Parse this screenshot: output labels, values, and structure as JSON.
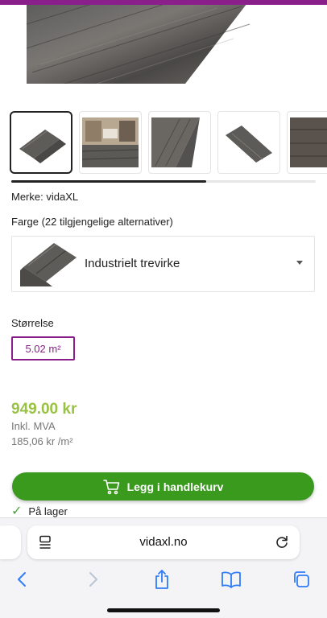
{
  "brand": {
    "label": "Merke: vidaXL"
  },
  "colors": {
    "label": "Farge (22 tilgjengelige alternativer)",
    "selected": "Industrielt trevirke"
  },
  "size": {
    "label": "Størrelse",
    "selected": "5.02 m²"
  },
  "pricing": {
    "price": "949.00 kr",
    "vat_note": "Inkl. MVA",
    "unit_price": "185,06 kr /m²"
  },
  "cart": {
    "button_label": "Legg i handlekurv",
    "icon": "cart-icon"
  },
  "stock": {
    "label": "På lager",
    "icon": "check-icon"
  },
  "browser": {
    "url": "vidaxl.no",
    "icons": [
      "reader-icon",
      "reload-icon",
      "back-icon",
      "forward-icon",
      "share-icon",
      "bookmarks-icon",
      "tabs-icon"
    ]
  },
  "theme": {
    "accent": "#8a1e8a",
    "price_color": "#99c244",
    "cart_green": "#3a9a1e"
  }
}
